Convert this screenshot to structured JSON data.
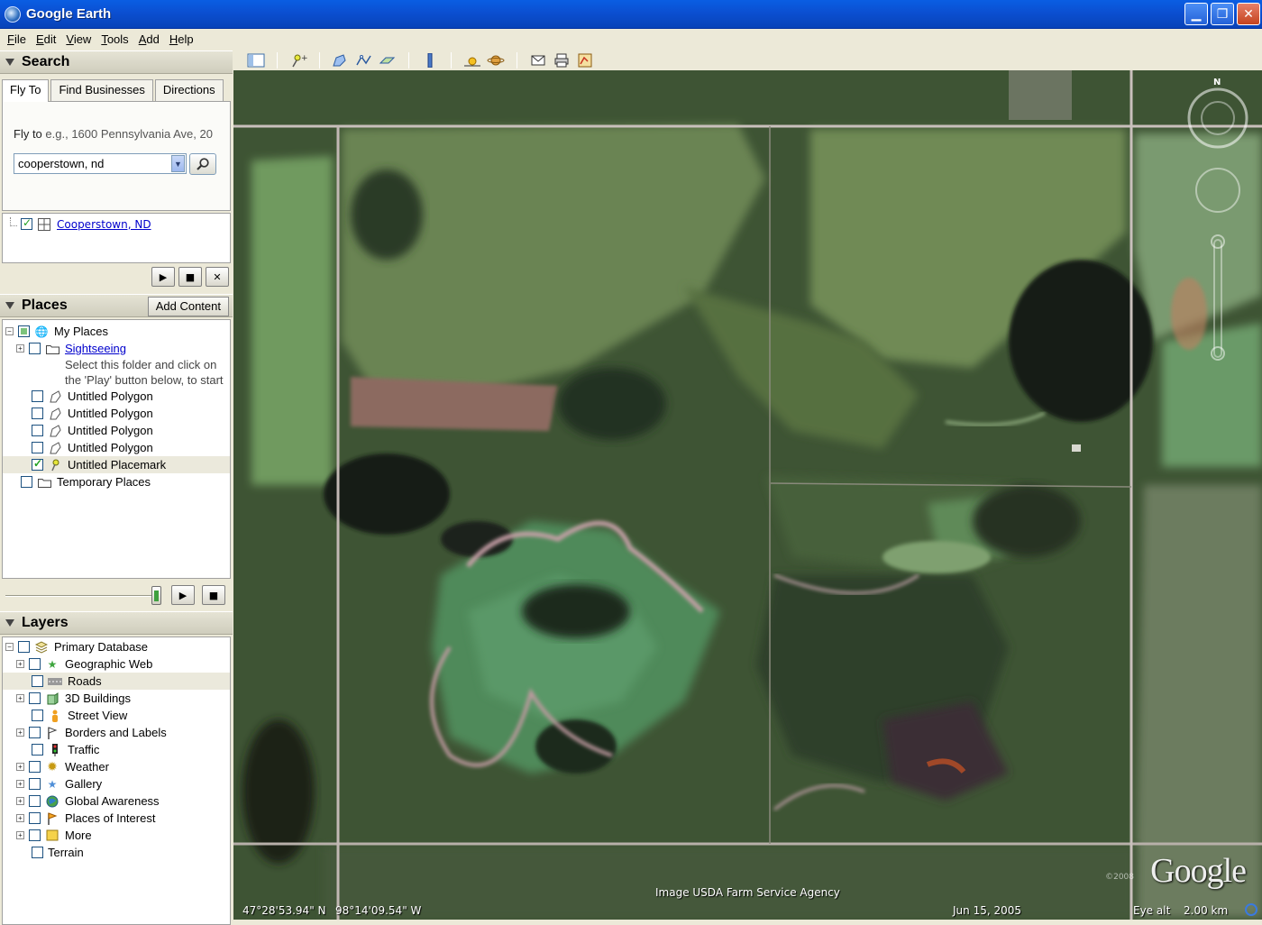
{
  "window": {
    "title": "Google Earth"
  },
  "menu": [
    "File",
    "Edit",
    "View",
    "Tools",
    "Add",
    "Help"
  ],
  "search": {
    "header": "Search",
    "tabs": [
      "Fly To",
      "Find Businesses",
      "Directions"
    ],
    "fly_to_label": "Fly to",
    "fly_to_placeholder": "e.g., 1600 Pennsylvania Ave, 20",
    "query": "cooperstown, nd",
    "result": "Cooperstown, ND"
  },
  "places": {
    "header": "Places",
    "add_content": "Add Content",
    "items": [
      {
        "label": "My Places",
        "indent": 0,
        "icon": "globe-icon",
        "expand": "-",
        "check": "partial"
      },
      {
        "label": "Sightseeing",
        "indent": 1,
        "icon": "folder-icon",
        "expand": "+",
        "check": "off",
        "link": true
      },
      {
        "label": "Untitled Polygon",
        "indent": 1,
        "icon": "polygon-icon",
        "check": "off"
      },
      {
        "label": "Untitled Polygon",
        "indent": 1,
        "icon": "polygon-icon",
        "check": "off"
      },
      {
        "label": "Untitled Polygon",
        "indent": 1,
        "icon": "polygon-icon",
        "check": "off"
      },
      {
        "label": "Untitled Polygon",
        "indent": 1,
        "icon": "polygon-icon",
        "check": "off"
      },
      {
        "label": "Untitled Placemark",
        "indent": 1,
        "icon": "pushpin-icon",
        "check": "on",
        "selected": true
      },
      {
        "label": "Temporary Places",
        "indent": 0,
        "icon": "folder-icon",
        "check": "off"
      }
    ],
    "sightseeing_desc": "Select this folder and click on the 'Play' button below, to start"
  },
  "layers": {
    "header": "Layers",
    "items": [
      {
        "label": "Primary Database",
        "indent": 0,
        "icon": "database-icon",
        "expand": "-"
      },
      {
        "label": "Geographic Web",
        "indent": 1,
        "icon": "star-icon",
        "expand": "+"
      },
      {
        "label": "Roads",
        "indent": 1,
        "icon": "road-icon",
        "selected": true
      },
      {
        "label": "3D Buildings",
        "indent": 1,
        "icon": "building-icon",
        "expand": "+"
      },
      {
        "label": "Street View",
        "indent": 1,
        "icon": "person-icon"
      },
      {
        "label": "Borders and Labels",
        "indent": 1,
        "icon": "flag-icon",
        "expand": "+"
      },
      {
        "label": "Traffic",
        "indent": 1,
        "icon": "traffic-light-icon"
      },
      {
        "label": "Weather",
        "indent": 1,
        "icon": "sun-icon",
        "expand": "+"
      },
      {
        "label": "Gallery",
        "indent": 1,
        "icon": "star-icon",
        "expand": "+"
      },
      {
        "label": "Global Awareness",
        "indent": 1,
        "icon": "globe-icon",
        "expand": "+"
      },
      {
        "label": "Places of Interest",
        "indent": 1,
        "icon": "flag-icon",
        "expand": "+"
      },
      {
        "label": "More",
        "indent": 1,
        "icon": "folder-icon",
        "expand": "+"
      },
      {
        "label": "Terrain",
        "indent": 0.5,
        "icon": ""
      }
    ]
  },
  "map": {
    "attribution": "Image USDA Farm Service Agency",
    "lat": "47°28'53.94\" N",
    "lon": "98°14'09.54\" W",
    "date": "Jun 15, 2005",
    "eye_alt_label": "Eye alt",
    "eye_alt": "2.00 km",
    "logo": "Google",
    "copyright": "©2008",
    "north": "N"
  }
}
